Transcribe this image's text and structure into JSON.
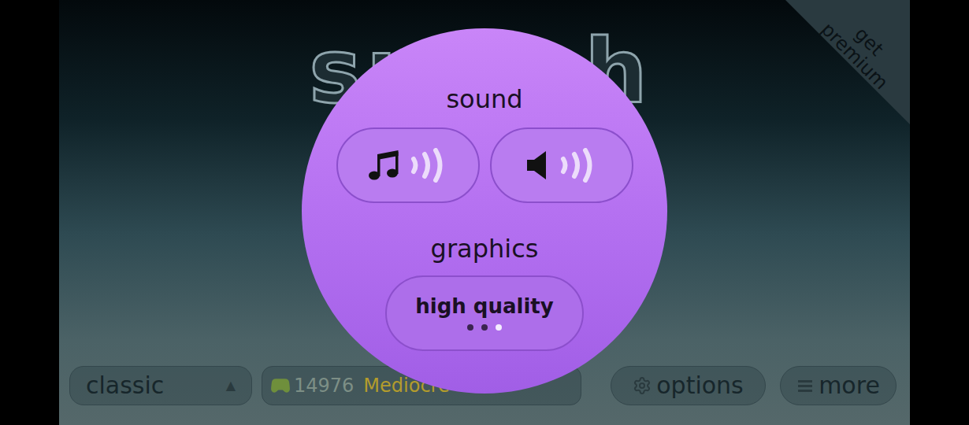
{
  "logo": "smash",
  "premium_badge": "get premium",
  "settings": {
    "sound_title": "sound",
    "sound_buttons": [
      {
        "kind": "music",
        "on": true
      },
      {
        "kind": "effects",
        "on": true
      }
    ],
    "graphics_title": "graphics",
    "graphics": {
      "value": "high quality",
      "options": [
        {
          "selected": false
        },
        {
          "selected": false
        },
        {
          "selected": true
        }
      ]
    }
  },
  "bottom_bar": {
    "mode": {
      "label": "classic",
      "arrow": "▲"
    },
    "score": {
      "value": "14976",
      "rank": "Mediocre"
    },
    "options_button": "options",
    "more_button": "more"
  }
}
